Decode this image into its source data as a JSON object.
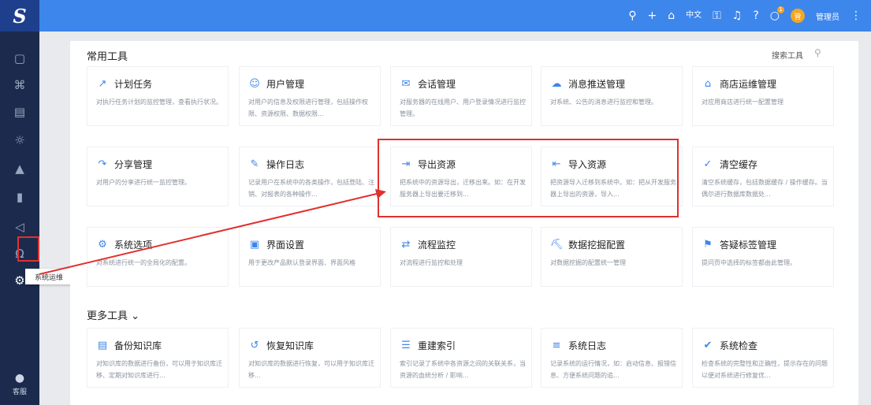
{
  "topbar": {
    "logo": "S",
    "icons": [
      "search-icon",
      "plus-icon",
      "home-icon",
      "lock-icon",
      "bell-icon",
      "help-icon",
      "message-icon"
    ],
    "lang": "中文",
    "notify_count": "1",
    "avatar": "管",
    "user": "管理员",
    "more": "⋮"
  },
  "sidebar": {
    "items": [
      "desktop-icon",
      "apps-icon",
      "database-icon",
      "analysis-icon",
      "report-icon",
      "chart-icon",
      "send-icon",
      "headset-icon",
      "tools-icon"
    ],
    "tooltip": "系统运维",
    "bottom_label": "客服"
  },
  "main": {
    "common_title": "常用工具",
    "search_label": "搜索工具",
    "more_title": "更多工具",
    "common_tools": [
      {
        "title": "计划任务",
        "icon": "chart-line-icon",
        "desc": "对执行任务计划的监控管理，查看执行状况。"
      },
      {
        "title": "用户管理",
        "icon": "user-icon",
        "desc": "对用户的信息及权限进行管理，包括操作权限、资源权限、数据权限..."
      },
      {
        "title": "会话管理",
        "icon": "chat-icon",
        "desc": "对服务器的在线用户、用户登录情况进行监控管理。"
      },
      {
        "title": "消息推送管理",
        "icon": "message-push-icon",
        "desc": "对系统、公告的消息进行监控和管理。"
      },
      {
        "title": "商店运维管理",
        "icon": "store-icon",
        "desc": "对应用商店进行统一配置管理"
      },
      {
        "title": "分享管理",
        "icon": "share-icon",
        "desc": "对用户的分享进行统一监控管理。"
      },
      {
        "title": "操作日志",
        "icon": "edit-log-icon",
        "desc": "记录用户在系统中的各类操作，包括登陆、注销、对报表的各种操作..."
      },
      {
        "title": "导出资源",
        "icon": "export-icon",
        "desc": "把系统中的资源导出，迁移出来。如：在开发服务器上导出要迁移到..."
      },
      {
        "title": "导入资源",
        "icon": "import-icon",
        "desc": "把资源导入迁移到系统中。如：把从开发服务器上导出的资源，导入..."
      },
      {
        "title": "清空缓存",
        "icon": "clear-cache-icon",
        "desc": "清空系统缓存，包括数据缓存 / 操作缓存。当偶尔进行数据库数据处..."
      },
      {
        "title": "系统选项",
        "icon": "settings-screen-icon",
        "desc": "对系统进行统一的全局化的配置。"
      },
      {
        "title": "界面设置",
        "icon": "interface-icon",
        "desc": "用于更改产品默认登录界面、界面风格"
      },
      {
        "title": "流程监控",
        "icon": "flow-icon",
        "desc": "对流程进行监控和处理"
      },
      {
        "title": "数据挖掘配置",
        "icon": "mining-icon",
        "desc": "对数据挖掘的配置统一管理"
      },
      {
        "title": "答疑标签管理",
        "icon": "tag-icon",
        "desc": "提问页中选择的标签都由此管理。"
      }
    ],
    "more_tools": [
      {
        "title": "备份知识库",
        "icon": "backup-icon",
        "desc": "对知识库的数据进行备份，可以用于知识库迁移、定期对知识库进行..."
      },
      {
        "title": "恢复知识库",
        "icon": "restore-icon",
        "desc": "对知识库的数据进行恢复，可以用于知识库迁移..."
      },
      {
        "title": "重建索引",
        "icon": "reindex-icon",
        "desc": "索引记录了系统中各资源之间的关联关系，当资源的血统分析 / 影响..."
      },
      {
        "title": "系统日志",
        "icon": "system-log-icon",
        "desc": "记录系统的运行情况，如：启动信息、报错信息、方便系统问题的追..."
      },
      {
        "title": "系统检查",
        "icon": "system-check-icon",
        "desc": "检查系统的完整性和正确性，提示存在的问题以便对系统进行修复优..."
      }
    ]
  }
}
